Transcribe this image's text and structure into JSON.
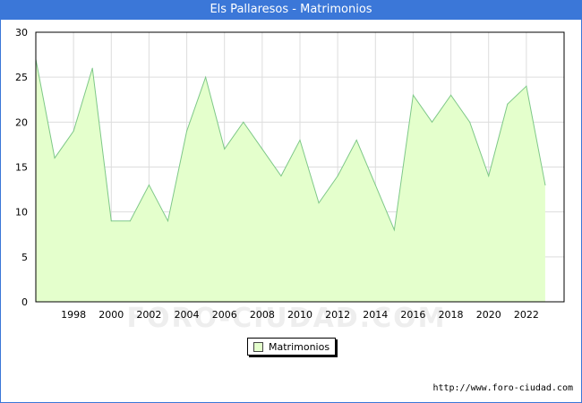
{
  "header": {
    "title": "Els Pallaresos - Matrimonios"
  },
  "legend": {
    "label": "Matrimonios"
  },
  "watermark": "FORO-CIUDAD.COM",
  "source": "http://www.foro-ciudad.com",
  "colors": {
    "title_bar": "#3b77d8",
    "fill": "#e4ffcc",
    "line": "#7ec888"
  },
  "chart_data": {
    "type": "area",
    "title": "Els Pallaresos - Matrimonios",
    "xlabel": "",
    "ylabel": "",
    "x": [
      1996,
      1997,
      1998,
      1999,
      2000,
      2001,
      2002,
      2003,
      2004,
      2005,
      2006,
      2007,
      2008,
      2009,
      2010,
      2011,
      2012,
      2013,
      2014,
      2015,
      2016,
      2017,
      2018,
      2019,
      2020,
      2021,
      2022,
      2023
    ],
    "series": [
      {
        "name": "Matrimonios",
        "values": [
          27,
          16,
          19,
          26,
          9,
          9,
          13,
          9,
          19,
          25,
          17,
          20,
          17,
          14,
          18,
          11,
          14,
          18,
          13,
          8,
          23,
          20,
          23,
          20,
          14,
          22,
          24,
          13
        ]
      }
    ],
    "xlim": [
      1996,
      2024
    ],
    "ylim": [
      0,
      30
    ],
    "yticks": [
      0,
      5,
      10,
      15,
      20,
      25,
      30
    ],
    "xticks": [
      1998,
      2000,
      2002,
      2004,
      2006,
      2008,
      2010,
      2012,
      2014,
      2016,
      2018,
      2020,
      2022
    ],
    "grid": true,
    "legend_position": "bottom"
  }
}
